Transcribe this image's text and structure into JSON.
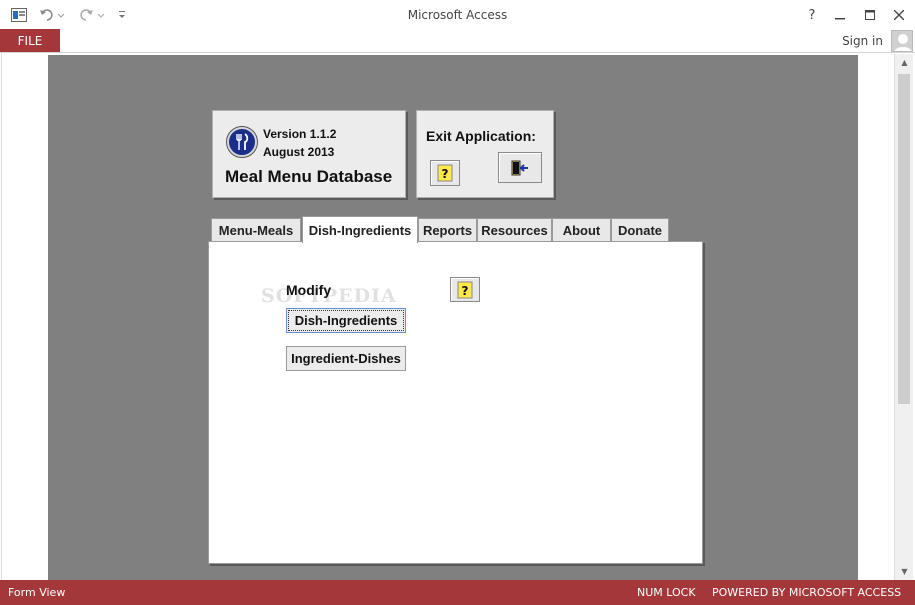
{
  "window": {
    "title": "Microsoft Access",
    "help": "?"
  },
  "ribbon": {
    "file_tab": "FILE",
    "sign_in": "Sign in"
  },
  "header": {
    "version": "Version 1.1.2",
    "date": "August 2013",
    "app_name": "Meal Menu Database",
    "exit_label": "Exit Application:"
  },
  "tabs": [
    {
      "label": "Menu-Meals"
    },
    {
      "label": "Dish-Ingredients"
    },
    {
      "label": "Reports"
    },
    {
      "label": "Resources"
    },
    {
      "label": "About"
    },
    {
      "label": "Donate"
    }
  ],
  "active_tab": "Dish-Ingredients",
  "page": {
    "section_label": "Modify",
    "buttons": [
      {
        "label": "Dish-Ingredients"
      },
      {
        "label": "Ingredient-Dishes"
      }
    ],
    "watermark": "SOFTPEDIA"
  },
  "statusbar": {
    "left": "Form View",
    "num_lock": "NUM LOCK",
    "powered": "POWERED BY MICROSOFT ACCESS"
  },
  "colors": {
    "accent": "#a4373a",
    "form_background": "#808080",
    "logo_blue": "#1b2f8a"
  }
}
